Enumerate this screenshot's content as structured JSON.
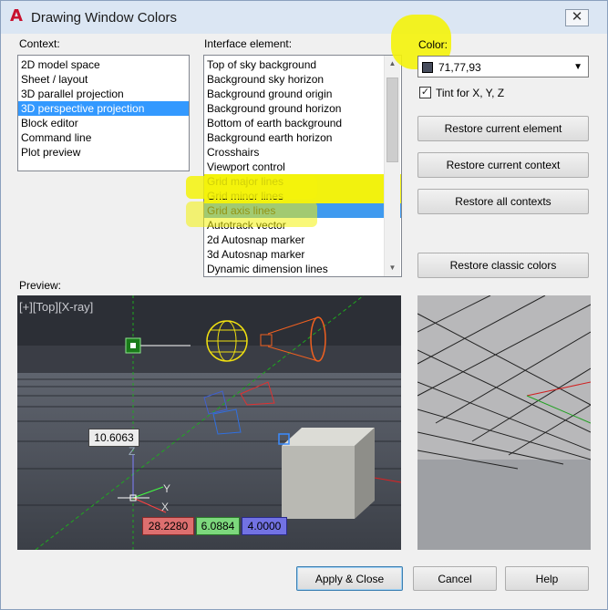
{
  "window": {
    "title": "Drawing Window Colors",
    "close_glyph": "✕",
    "app_icon": "autocad-icon"
  },
  "context": {
    "label": "Context:",
    "items": [
      "2D model space",
      "Sheet / layout",
      "3D parallel projection",
      "3D perspective projection",
      "Block editor",
      "Command line",
      "Plot preview"
    ],
    "selected": "3D perspective projection"
  },
  "interface": {
    "label": "Interface element:",
    "items": [
      "Top of sky background",
      "Background sky horizon",
      "Background ground origin",
      "Background ground horizon",
      "Bottom of earth background",
      "Background earth horizon",
      "Crosshairs",
      "Viewport control",
      "Grid major lines",
      "Grid minor lines",
      "Grid axis lines",
      "Autotrack vector",
      "2d Autosnap marker",
      "3d Autosnap marker",
      "Dynamic dimension lines"
    ],
    "selected": "Grid axis lines"
  },
  "color": {
    "label": "Color:",
    "value": "71,77,93",
    "swatch": "#474d5d"
  },
  "tint": {
    "label": "Tint for X, Y, Z",
    "checked": "✓"
  },
  "buttons": {
    "restore_element": "Restore current element",
    "restore_context": "Restore current context",
    "restore_all": "Restore all contexts",
    "restore_classic": "Restore classic colors",
    "apply_close": "Apply & Close",
    "cancel": "Cancel",
    "help": "Help"
  },
  "preview": {
    "label": "Preview:",
    "viewport_label": "[+][Top][X-ray]",
    "dim_main": "10.6063",
    "dim_x": "28.2280",
    "dim_y": "6.0884",
    "dim_z": "4.0000",
    "axis_z": "Z",
    "axis_y": "Y",
    "axis_x": "X"
  },
  "colors": {
    "accent": "#3399ff",
    "highlight": "#f4f30a",
    "viewport_bg": "#2c2f36"
  }
}
